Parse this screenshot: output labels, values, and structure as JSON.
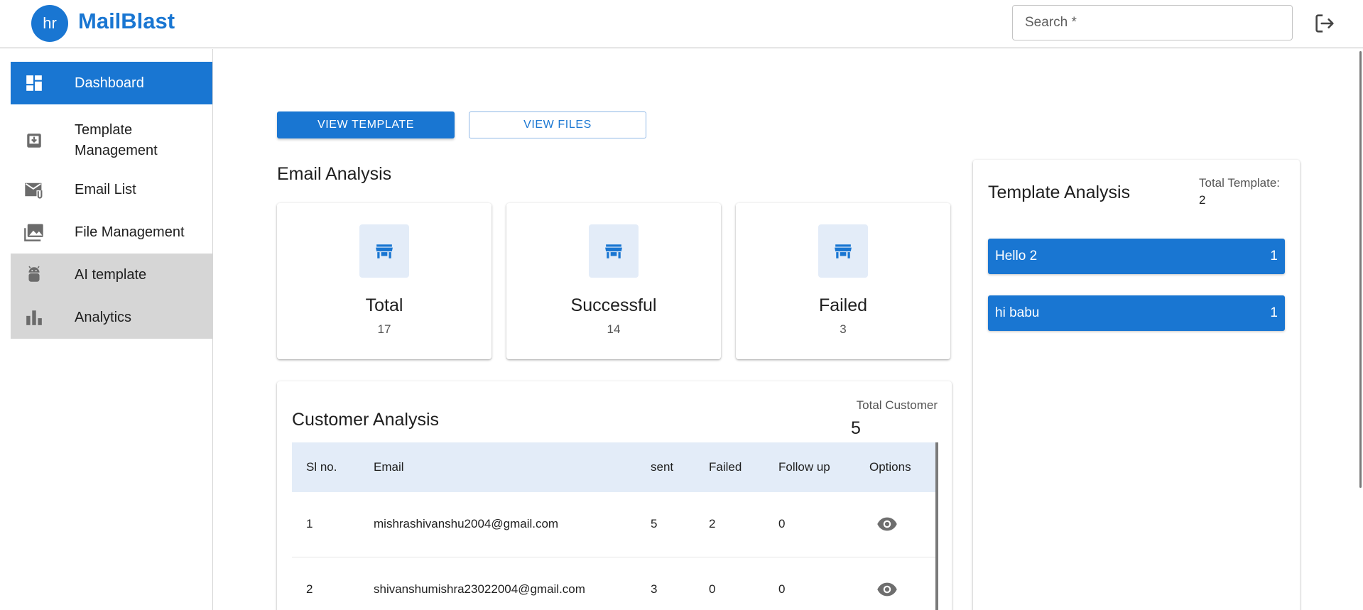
{
  "header": {
    "logo_text": "hr",
    "brand": "MailBlast",
    "search_placeholder": "Search *",
    "logout_icon": "logout-icon"
  },
  "sidebar": {
    "items": [
      {
        "label": "Dashboard",
        "icon": "dashboard-icon",
        "state": "active"
      },
      {
        "label": "Template Management",
        "icon": "template-download-icon",
        "state": "normal"
      },
      {
        "label": "Email List",
        "icon": "email-attachment-icon",
        "state": "normal"
      },
      {
        "label": "File Management",
        "icon": "photo-library-icon",
        "state": "normal"
      },
      {
        "label": "AI template",
        "icon": "android-icon",
        "state": "highlighted"
      },
      {
        "label": "Analytics",
        "icon": "bar-chart-icon",
        "state": "highlighted"
      }
    ]
  },
  "actions": {
    "view_template": "VIEW TEMPLATE",
    "view_files": "VIEW FILES"
  },
  "email_analysis": {
    "title": "Email Analysis",
    "cards": [
      {
        "label": "Total",
        "value": "17",
        "icon": "store-icon"
      },
      {
        "label": "Successful",
        "value": "14",
        "icon": "store-icon"
      },
      {
        "label": "Failed",
        "value": "3",
        "icon": "store-icon"
      }
    ]
  },
  "customer_analysis": {
    "title": "Customer Analysis",
    "total_label": "Total Customer",
    "total_value": "5",
    "columns": [
      "Sl no.",
      "Email",
      "sent",
      "Failed",
      "Follow up",
      "Options"
    ],
    "rows": [
      {
        "sl": "1",
        "email": "mishrashivanshu2004@gmail.com",
        "sent": "5",
        "failed": "2",
        "follow_up": "0"
      },
      {
        "sl": "2",
        "email": "shivanshumishra23022004@gmail.com",
        "sent": "3",
        "failed": "0",
        "follow_up": "0"
      }
    ]
  },
  "template_analysis": {
    "title": "Template Analysis",
    "total_label": "Total Template:",
    "total_value": "2",
    "items": [
      {
        "name": "Hello 2",
        "count": "1"
      },
      {
        "name": "hi babu",
        "count": "1"
      }
    ]
  },
  "colors": {
    "primary": "#1976d2",
    "highlight_bg": "#d6d6d6",
    "soft_blue": "#e3ecf8"
  }
}
